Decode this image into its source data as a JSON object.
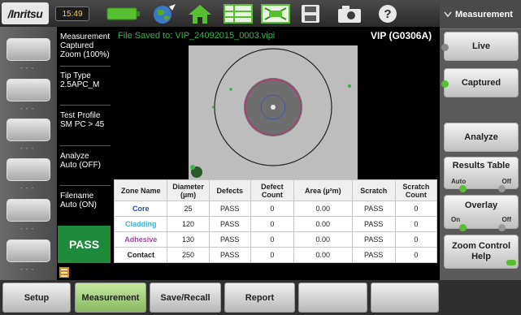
{
  "brand": "/Inritsu",
  "clock": "15:49",
  "status_line": "File Saved to:  VIP_24092015_0003.vipi",
  "device": "VIP (G0306A)",
  "info": {
    "measurement": [
      "Measurement",
      "Captured",
      "Zoom (100%)"
    ],
    "tip_type": [
      "Tip Type",
      "2.5APC_M"
    ],
    "test_profile": [
      "Test Profile",
      "SM PC > 45"
    ],
    "analyze": [
      "Analyze",
      "Auto (OFF)"
    ],
    "filename": [
      "Filename",
      "Auto (ON)"
    ]
  },
  "result": "PASS",
  "left_button_dash": "- - -",
  "table": {
    "headers": [
      "Zone Name",
      "Diameter (µm)",
      "Defects",
      "Defect Count",
      "Area (µ²m)",
      "Scratch",
      "Scratch Count"
    ],
    "rows": [
      {
        "zone": "Core",
        "color": "#2a4aa8",
        "diameter": "25",
        "defects": "PASS",
        "defect_count": "0",
        "area": "0.00",
        "scratch": "PASS",
        "scratch_count": "0"
      },
      {
        "zone": "Cladding",
        "color": "#3ab0d8",
        "diameter": "120",
        "defects": "PASS",
        "defect_count": "0",
        "area": "0.00",
        "scratch": "PASS",
        "scratch_count": "0"
      },
      {
        "zone": "Adhesive",
        "color": "#b040a8",
        "diameter": "130",
        "defects": "PASS",
        "defect_count": "0",
        "area": "0.00",
        "scratch": "PASS",
        "scratch_count": "0"
      },
      {
        "zone": "Contact",
        "color": "#222222",
        "diameter": "250",
        "defects": "PASS",
        "defect_count": "0",
        "area": "0.00",
        "scratch": "PASS",
        "scratch_count": "0"
      }
    ]
  },
  "bottom_buttons": [
    "Setup",
    "Measurement",
    "Save/Recall",
    "Report",
    "",
    ""
  ],
  "right": {
    "header": "Measurement",
    "live": "Live",
    "captured": "Captured",
    "analyze": "Analyze",
    "results_table": {
      "label": "Results Table",
      "opt1": "Auto",
      "opt2": "Off"
    },
    "overlay": {
      "label": "Overlay",
      "opt1": "On",
      "opt2": "Off"
    },
    "zoom_help": [
      "Zoom Control",
      "Help"
    ]
  },
  "colors": {
    "pass_green": "#1f8a3a",
    "status_green": "#3ab44a",
    "active_tab": "#a8d080"
  }
}
